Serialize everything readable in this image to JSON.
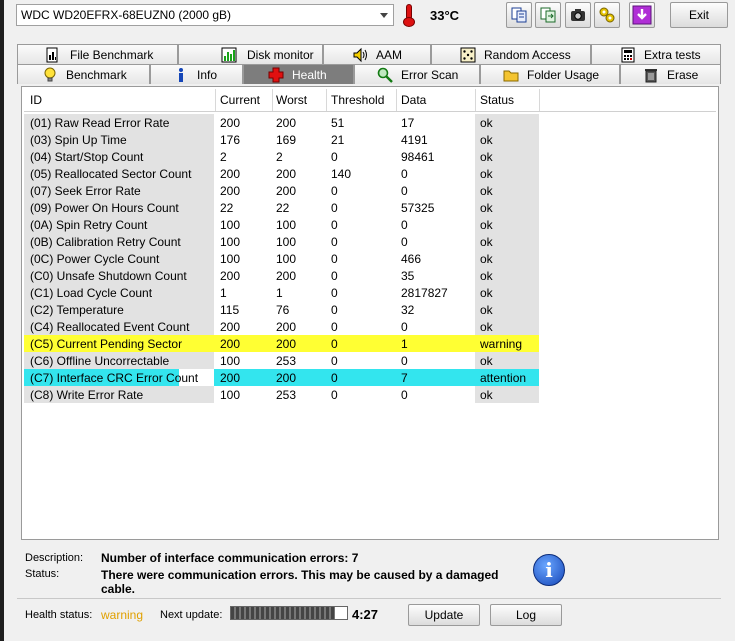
{
  "drive": {
    "name": "WDC WD20EFRX-68EUZN0 (2000 gB)"
  },
  "temperature": "33°C",
  "toolbar": {
    "buttons": [
      "copy-icon",
      "export-icon",
      "camera-icon",
      "tools-icon",
      "download-icon"
    ],
    "exit_label": "Exit"
  },
  "tabs_top": [
    {
      "label": "File Benchmark",
      "icon": "file-benchmark-icon"
    },
    {
      "label": "Disk monitor",
      "icon": "disk-monitor-icon"
    },
    {
      "label": "AAM",
      "icon": "speaker-icon"
    },
    {
      "label": "Random Access",
      "icon": "dice-icon"
    },
    {
      "label": "Extra tests",
      "icon": "calculator-icon"
    }
  ],
  "tabs_bottom": [
    {
      "label": "Benchmark",
      "icon": "lightbulb-icon"
    },
    {
      "label": "Info",
      "icon": "info-icon"
    },
    {
      "label": "Health",
      "icon": "health-cross-icon",
      "active": true
    },
    {
      "label": "Error Scan",
      "icon": "magnifier-icon"
    },
    {
      "label": "Folder Usage",
      "icon": "folder-icon"
    },
    {
      "label": "Erase",
      "icon": "trash-icon"
    }
  ],
  "table": {
    "headers": [
      "ID",
      "Current",
      "Worst",
      "Threshold",
      "Data",
      "Status"
    ],
    "rows": [
      {
        "id": "(01) Raw Read Error Rate",
        "current": "200",
        "worst": "200",
        "threshold": "51",
        "data": "17",
        "status": "ok",
        "highlight": ""
      },
      {
        "id": "(03) Spin Up Time",
        "current": "176",
        "worst": "169",
        "threshold": "21",
        "data": "4191",
        "status": "ok",
        "highlight": ""
      },
      {
        "id": "(04) Start/Stop Count",
        "current": "2",
        "worst": "2",
        "threshold": "0",
        "data": "98461",
        "status": "ok",
        "highlight": ""
      },
      {
        "id": "(05) Reallocated Sector Count",
        "current": "200",
        "worst": "200",
        "threshold": "140",
        "data": "0",
        "status": "ok",
        "highlight": ""
      },
      {
        "id": "(07) Seek Error Rate",
        "current": "200",
        "worst": "200",
        "threshold": "0",
        "data": "0",
        "status": "ok",
        "highlight": ""
      },
      {
        "id": "(09) Power On Hours Count",
        "current": "22",
        "worst": "22",
        "threshold": "0",
        "data": "57325",
        "status": "ok",
        "highlight": ""
      },
      {
        "id": "(0A) Spin Retry Count",
        "current": "100",
        "worst": "100",
        "threshold": "0",
        "data": "0",
        "status": "ok",
        "highlight": ""
      },
      {
        "id": "(0B) Calibration Retry Count",
        "current": "100",
        "worst": "100",
        "threshold": "0",
        "data": "0",
        "status": "ok",
        "highlight": ""
      },
      {
        "id": "(0C) Power Cycle Count",
        "current": "100",
        "worst": "100",
        "threshold": "0",
        "data": "466",
        "status": "ok",
        "highlight": ""
      },
      {
        "id": "(C0) Unsafe Shutdown Count",
        "current": "200",
        "worst": "200",
        "threshold": "0",
        "data": "35",
        "status": "ok",
        "highlight": ""
      },
      {
        "id": "(C1) Load Cycle Count",
        "current": "1",
        "worst": "1",
        "threshold": "0",
        "data": "2817827",
        "status": "ok",
        "highlight": ""
      },
      {
        "id": "(C2) Temperature",
        "current": "115",
        "worst": "76",
        "threshold": "0",
        "data": "32",
        "status": "ok",
        "highlight": ""
      },
      {
        "id": "(C4) Reallocated Event Count",
        "current": "200",
        "worst": "200",
        "threshold": "0",
        "data": "0",
        "status": "ok",
        "highlight": ""
      },
      {
        "id": "(C5) Current Pending Sector",
        "current": "200",
        "worst": "200",
        "threshold": "0",
        "data": "1",
        "status": "warning",
        "highlight": "warning"
      },
      {
        "id": "(C6) Offline Uncorrectable",
        "current": "100",
        "worst": "253",
        "threshold": "0",
        "data": "0",
        "status": "ok",
        "highlight": ""
      },
      {
        "id": "(C7) Interface CRC Error Count",
        "current": "200",
        "worst": "200",
        "threshold": "0",
        "data": "7",
        "status": "attention",
        "highlight": "attention"
      },
      {
        "id": "(C8) Write Error Rate",
        "current": "100",
        "worst": "253",
        "threshold": "0",
        "data": "0",
        "status": "ok",
        "highlight": ""
      }
    ]
  },
  "details": {
    "description_label": "Description:",
    "description_text": "Number of interface communication errors: 7",
    "status_label": "Status:",
    "status_text_line1": "There were communication errors. This may be caused by a damaged",
    "status_text_line2": "cable."
  },
  "footer": {
    "health_label": "Health status:",
    "health_value": "warning",
    "health_color": "#e0a000",
    "next_update_label": "Next update:",
    "progress_percent": 90,
    "countdown": "4:27",
    "update_label": "Update",
    "log_label": "Log"
  },
  "colors": {
    "warning": "#ffff33",
    "attention": "#33e5ee",
    "active_tab": "#7d7d7d"
  }
}
